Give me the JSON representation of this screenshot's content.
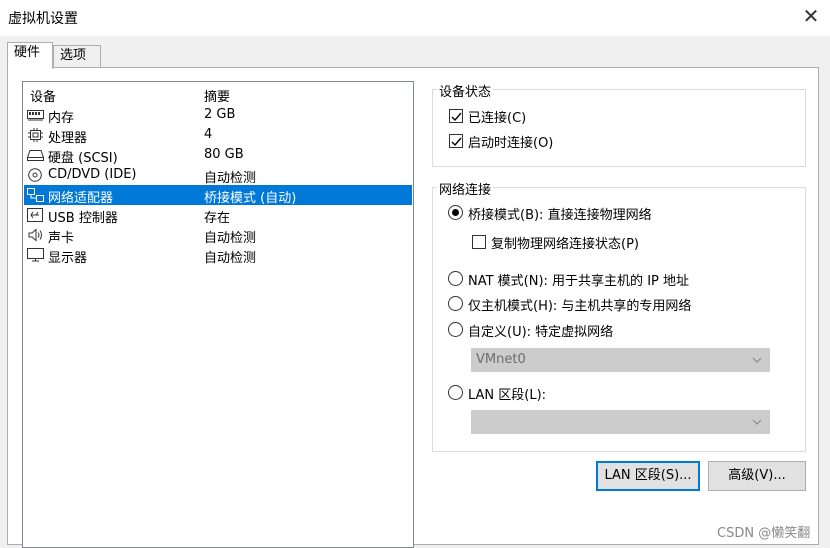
{
  "window": {
    "title": "虚拟机设置",
    "close_icon": "✕"
  },
  "tabs": [
    {
      "label": "硬件",
      "active": true
    },
    {
      "label": "选项",
      "active": false
    }
  ],
  "device_list": {
    "header": {
      "device": "设备",
      "summary": "摘要"
    },
    "rows": [
      {
        "icon": "memory-icon",
        "device": "内存",
        "summary": "2 GB",
        "selected": false
      },
      {
        "icon": "processor-icon",
        "device": "处理器",
        "summary": "4",
        "selected": false
      },
      {
        "icon": "harddisk-icon",
        "device": "硬盘 (SCSI)",
        "summary": "80 GB",
        "selected": false
      },
      {
        "icon": "cd-dvd-icon",
        "device": "CD/DVD (IDE)",
        "summary": "自动检测",
        "selected": false
      },
      {
        "icon": "network-adapter-icon",
        "device": "网络适配器",
        "summary": "桥接模式 (自动)",
        "selected": true
      },
      {
        "icon": "usb-controller-icon",
        "device": "USB 控制器",
        "summary": "存在",
        "selected": false
      },
      {
        "icon": "sound-card-icon",
        "device": "声卡",
        "summary": "自动检测",
        "selected": false
      },
      {
        "icon": "display-icon",
        "device": "显示器",
        "summary": "自动检测",
        "selected": false
      }
    ]
  },
  "device_status": {
    "label": "设备状态",
    "connected": {
      "label": "已连接(C)",
      "checked": true
    },
    "connect_at_power_on": {
      "label": "启动时连接(O)",
      "checked": true
    }
  },
  "network_connection": {
    "label": "网络连接",
    "bridged": {
      "label": "桥接模式(B): 直接连接物理网络",
      "selected": true
    },
    "replicate_state": {
      "label": "复制物理网络连接状态(P)",
      "checked": false
    },
    "nat": {
      "label": "NAT 模式(N): 用于共享主机的 IP 地址",
      "selected": false
    },
    "host_only": {
      "label": "仅主机模式(H): 与主机共享的专用网络",
      "selected": false
    },
    "custom": {
      "label": "自定义(U): 特定虚拟网络",
      "selected": false
    },
    "custom_select": {
      "value": "VMnet0"
    },
    "lan_segment": {
      "label": "LAN 区段(L):",
      "selected": false
    },
    "lan_select": {
      "value": ""
    }
  },
  "buttons": {
    "lan_segments": "LAN 区段(S)...",
    "advanced": "高级(V)..."
  },
  "watermark": "CSDN @懒笑翻",
  "colors": {
    "selection": "#0078d7",
    "dialog_bg": "#f0f0f0",
    "disabled_combo": "#cccccc"
  }
}
